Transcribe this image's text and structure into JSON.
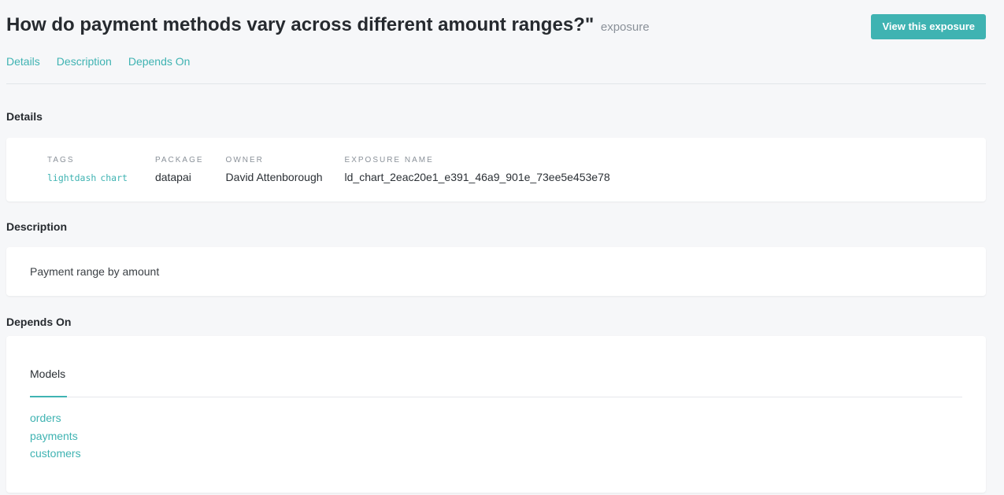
{
  "header": {
    "title": "How do payment methods vary across different amount ranges?\"",
    "resource_type": "exposure",
    "view_button": "View this exposure"
  },
  "nav": {
    "details": "Details",
    "description": "Description",
    "depends_on": "Depends On"
  },
  "details": {
    "heading": "Details",
    "tags_label": "TAGS",
    "tags": [
      "lightdash",
      "chart"
    ],
    "package_label": "PACKAGE",
    "package": "datapai",
    "owner_label": "OWNER",
    "owner": "David Attenborough",
    "exposure_name_label": "EXPOSURE NAME",
    "exposure_name": "ld_chart_2eac20e1_e391_46a9_901e_73ee5e453e78"
  },
  "description": {
    "heading": "Description",
    "text": "Payment range by amount"
  },
  "depends_on": {
    "heading": "Depends On",
    "tab": "Models",
    "models": [
      "orders",
      "payments",
      "customers"
    ]
  },
  "colors": {
    "accent": "#3fb3b2",
    "background": "#f6f7f9"
  }
}
